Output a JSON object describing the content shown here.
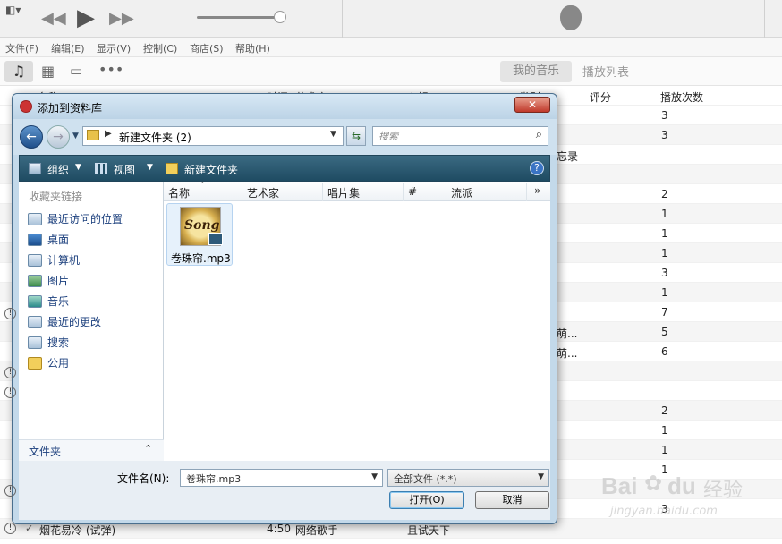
{
  "menu": [
    "文件(F)",
    "编辑(E)",
    "显示(V)",
    "控制(C)",
    "商店(S)",
    "帮助(H)"
  ],
  "tabs": {
    "my_music": "我的音乐",
    "playlists": "播放列表"
  },
  "table": {
    "headers": {
      "name": "名称",
      "time": "时间",
      "artist": "艺术家",
      "album": "专辑",
      "genre": "类别",
      "rating": "评分",
      "plays": "播放次数"
    },
    "plays": [
      "3",
      "3",
      "",
      "",
      "2",
      "1",
      "1",
      "1",
      "3",
      "1",
      "7",
      "5",
      "6",
      "",
      "",
      "2",
      "1",
      "1",
      "1",
      "",
      "3"
    ],
    "genre_fragments": [
      "忘录",
      "萌...",
      "萌..."
    ],
    "last_row": {
      "name": "烟花易冷 (试弹)",
      "time": "4:50",
      "artist": "网络歌手",
      "album": "且试天下"
    }
  },
  "dialog": {
    "title": "添加到资料库",
    "path_folder": "新建文件夹 (2)",
    "search_placeholder": "搜索",
    "cmd": {
      "organize": "组织",
      "view": "视图",
      "new_folder": "新建文件夹"
    },
    "nav_header": "收藏夹链接",
    "nav_items": [
      "最近访问的位置",
      "桌面",
      "计算机",
      "图片",
      "音乐",
      "最近的更改",
      "搜索",
      "公用"
    ],
    "folders_label": "文件夹",
    "columns": [
      "名称",
      "艺术家",
      "唱片集",
      "#",
      "流派"
    ],
    "file": {
      "name": "卷珠帘.mp3",
      "art_text": "Song"
    },
    "filename_label": "文件名(N):",
    "filename_value": "卷珠帘.mp3",
    "filetype_value": "全部文件 (*.*)",
    "open_button": "打开(O)",
    "cancel_button": "取消"
  },
  "watermark": {
    "brand": "Bai",
    "brand2": "du",
    "text": "经验",
    "url": "jingyan.baidu.com"
  },
  "colors": {
    "accent": "#2d5a7a",
    "title_blue": "#1a3e7c"
  }
}
